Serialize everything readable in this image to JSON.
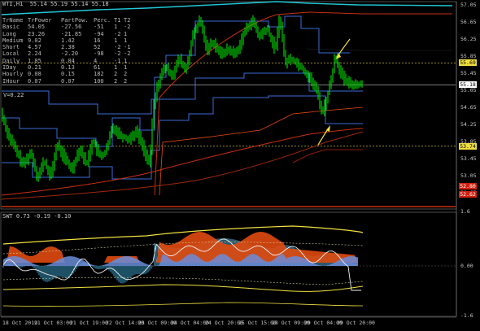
{
  "header": {
    "title": "WTI,H1  55.14 55.19 55.14 55.18"
  },
  "table": {
    "headers": [
      "TrName",
      "TrPower",
      "PartPow.",
      "Perc.",
      "T1",
      "T2"
    ],
    "rows": [
      [
        "Basic",
        "54.05",
        "-27.56",
        "-51",
        "1",
        "-2"
      ],
      [
        "Long",
        "23.26",
        "-21.85",
        "-94",
        "-2",
        "1"
      ],
      [
        "Medium",
        "9.02",
        "1.42",
        "16",
        "1",
        "1"
      ],
      [
        "Short",
        "4.57",
        "2.38",
        "52",
        "-2",
        "-1"
      ],
      [
        "Local",
        "2.24",
        "-2.20",
        "-98",
        "-2",
        "-2"
      ],
      [
        "Daily",
        "1.85",
        "0.04",
        "4",
        "-1",
        "1"
      ],
      [
        "IDay",
        "0.21",
        "0.13",
        "61",
        "1",
        "1"
      ],
      [
        "Hourly",
        "0.08",
        "0.15",
        "182",
        "2",
        "2"
      ],
      [
        "IHour",
        "0.07",
        "0.07",
        "100",
        "2",
        "2"
      ]
    ]
  },
  "v_label": "V=0.22",
  "price_axis": [
    "57.05",
    "56.65",
    "56.25",
    "55.85",
    "55.45",
    "55.05",
    "54.65",
    "54.25",
    "53.85",
    "53.45",
    "53.05",
    "52.65"
  ],
  "price_badges": [
    {
      "text": "55.69",
      "price": 55.69,
      "color": "#f0e040",
      "fg": "#000000"
    },
    {
      "text": "55.18",
      "price": 55.18,
      "color": "#ffffff",
      "fg": "#000000"
    },
    {
      "text": "53.74",
      "price": 53.74,
      "color": "#f0e040",
      "fg": "#000000"
    },
    {
      "text": "52.80",
      "price": 52.8,
      "color": "#d02010",
      "fg": "#ffffff"
    },
    {
      "text": "52.62",
      "price": 52.62,
      "color": "#d02010",
      "fg": "#ffffff"
    }
  ],
  "indicator": {
    "title": "SWT 0.73 -0.19 -0.10",
    "axis": [
      "1.6",
      "0.00",
      "-1.6"
    ]
  },
  "time_axis": [
    "18 Oct 2019",
    "21 Oct 03:00",
    "21 Oct 19:00",
    "22 Oct 14:00",
    "23 Oct 09:00",
    "24 Oct 04:00",
    "24 Oct 20:00",
    "25 Oct 15:00",
    "28 Oct 09:00",
    "29 Oct 04:00",
    "29 Oct 20:00"
  ],
  "colors": {
    "candle": "#00e000",
    "cyan": "#20c8d8",
    "blue": "#3a6cd8",
    "red": "#c83010",
    "yellow": "#f0e040",
    "orange": "#e84a10"
  }
}
